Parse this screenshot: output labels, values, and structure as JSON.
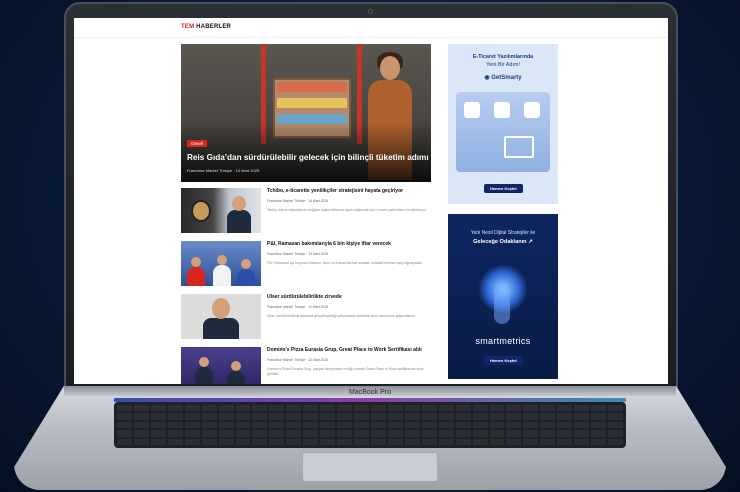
{
  "site": {
    "logo_accent": "TEM",
    "logo_rest": "HABERLER"
  },
  "hero": {
    "tag": "Genel",
    "title": "Reis Gıda’dan sürdürülebilir gelecek için bilinçli tüketim adımı",
    "meta": "Franchise Market Türkiye · 14 Mart 2025"
  },
  "news": [
    {
      "title": "Tchibo, e-ticarette yenilikçiler stratejisini hayata geçiriyor",
      "meta": "Franchise Market Türkiye · 14 Mart 2025",
      "desc": "Tchibo, kahve tutkunlarının değişen alışkanlıklarına uyum sağlamak için e-ticaret yatırımlarını hızlandırıyor."
    },
    {
      "title": "P&I, Ramazan bakımılarıyla 6 bin kişiye iftar verecek",
      "meta": "Franchise Market Türkiye · 13 Mart 2025",
      "desc": "P&I, Ramazan ayı boyunca İstanbul, İzmir ve Ankara'da iftar sofraları kurarak binlerce kişiyi ağırlayacak."
    },
    {
      "title": "Ülser sürdürülebilirlikte zirvede",
      "meta": "Franchise Market Türkiye · 12 Mart 2025",
      "desc": "Ülser, sürdürülebilirlik alanında gerçekleştirdiği çalışmalarla sektörde öncü konumunu güçlendiriyor."
    },
    {
      "title": "Domino's Pizza Eurasia Grup, Great Place to Work Sertifikası aldı",
      "meta": "Franchise Market Türkiye · 12 Mart 2025",
      "desc": "Domino's Pizza Eurasia Grup, çalışan deneyimine verdiği önemle Great Place to Work sertifikasına layık görüldü."
    }
  ],
  "ads": {
    "ad1": {
      "line1": "E-Ticaret Yazılımlarında",
      "line2": "Yeni Bir Adım!",
      "brand": "GetSmarty",
      "button": "Hemen Keşfet"
    },
    "ad2": {
      "line1": "Yeni Nesil Dijital Stratejiler ile",
      "line2": "Geleceğe Odaklanın",
      "brand": "smartmetrics",
      "button": "Hemen Keşfet"
    }
  },
  "device": {
    "model": "MacBook Pro"
  }
}
